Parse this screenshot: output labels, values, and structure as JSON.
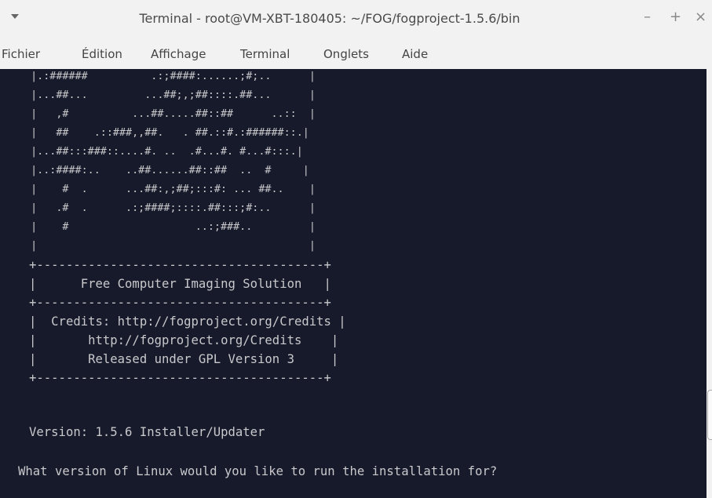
{
  "window": {
    "title": "Terminal - root@VM-XBT-180405: ~/FOG/fogproject-1.5.6/bin",
    "buttons": {
      "minimize": "–",
      "maximize": "+",
      "close": "×"
    }
  },
  "menu": {
    "items": [
      "Fichier",
      "Édition",
      "Affichage",
      "Terminal",
      "Onglets",
      "Aide"
    ]
  },
  "terminal": {
    "art_lines": [
      "  |.:######          .:;####:......;#;..      |",
      "  |...##...         ...##;,;##::::.##...      |",
      "  |   ,#          ...##.....##::##      ..::  |",
      "  |   ##    .::###,,##.   . ##.::#.:######::.|",
      "  |...##:::###::....#. ..  .#...#. #...#:::.|",
      "  |..:####:..    ..##......##::##  ..  #     |",
      "  |    #  .      ...##:,;##;:::#: ... ##..    |",
      "  |   .#  .      .:;####;::::.##:::;#:..      |",
      "  |    #                    ..:;###..         |",
      "  |                                           |"
    ],
    "box_lines": [
      "+---------------------------------------+",
      "|      Free Computer Imaging Solution   |",
      "+---------------------------------------+",
      "|  Credits: http://fogproject.org/Credits |",
      "|       http://fogproject.org/Credits    |",
      "|       Released under GPL Version 3     |",
      "+---------------------------------------+"
    ],
    "version_line": "Version: 1.5.6 Installer/Updater",
    "question_line": "What version of Linux would you like to run the installation for?"
  }
}
